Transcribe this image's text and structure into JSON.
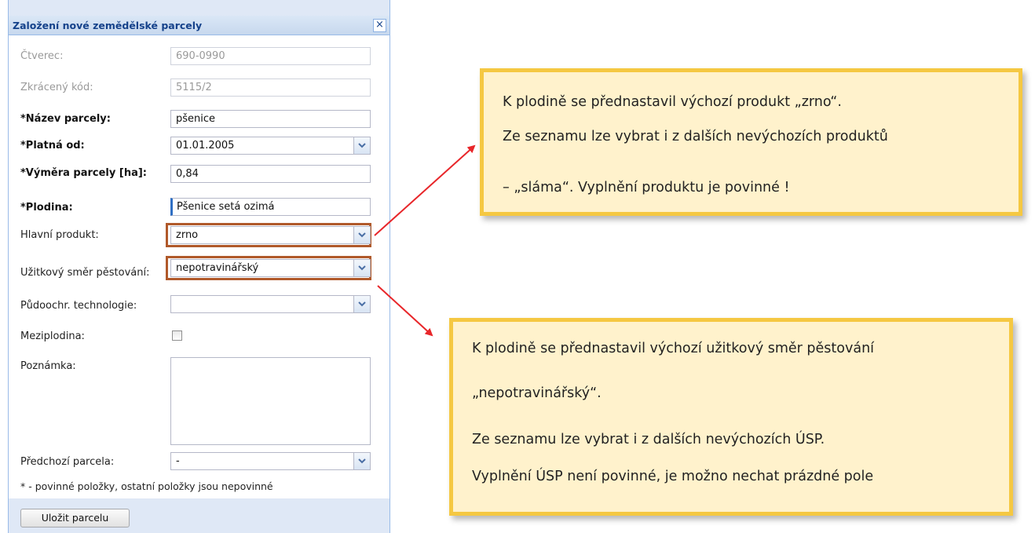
{
  "dialog": {
    "title": "Založení nové zemědělské parcely",
    "close_symbol": "×",
    "fields": {
      "ctverec": {
        "label": "Čtverec:",
        "value": "690-0990"
      },
      "zkraceny_kod": {
        "label": "Zkrácený kód:",
        "value": "5115/2"
      },
      "nazev": {
        "label": "*Název parcely:",
        "value": "pšenice"
      },
      "platna_od": {
        "label": "*Platná od:",
        "value": "01.01.2005"
      },
      "vymera": {
        "label": "*Výměra parcely [ha]:",
        "value": "0,84"
      },
      "plodina": {
        "label": "*Plodina:",
        "value": "Pšenice setá ozimá"
      },
      "hlavni_produkt": {
        "label": "Hlavní produkt:",
        "value": "zrno"
      },
      "uzitkovy_smer": {
        "label": "Užitkový směr pěstování:",
        "value": "nepotravinářský"
      },
      "pudoochr": {
        "label": "Půdoochr. technologie:",
        "value": ""
      },
      "meziplodina": {
        "label": "Meziplodina:",
        "checked": false
      },
      "poznamka": {
        "label": "Poznámka:",
        "value": ""
      },
      "predchozi": {
        "label": "Předchozí parcela:",
        "value": "-"
      }
    },
    "note": "* - povinné položky, ostatní položky jsou nepovinné",
    "save_button": "Uložit parcelu"
  },
  "callouts": {
    "top": {
      "line1": "K plodině se přednastavil výchozí produkt „zrno“.",
      "line2": "Ze seznamu lze vybrat i z dalších nevýchozích produktů",
      "line3": "– „sláma“. Vyplnění produktu je povinné !"
    },
    "bottom": {
      "line1": "K plodině se přednastavil výchozí užitkový směr pěstování",
      "line2": "„nepotravinářský“.",
      "line3": "Ze seznamu lze vybrat i z dalších nevýchozích ÚSP.",
      "line4": "Vyplnění ÚSP není povinné, je možno nechat prázdné pole"
    }
  },
  "colors": {
    "highlight_box": "#b0592a",
    "arrow": "#e8262a",
    "callout_fill": "#fff2cc",
    "callout_border": "#f5c842",
    "dialog_title": "#15428b"
  },
  "icons": {
    "close": "close-icon",
    "dropdown": "chevron-down-icon",
    "arrow": "arrow-icon"
  }
}
